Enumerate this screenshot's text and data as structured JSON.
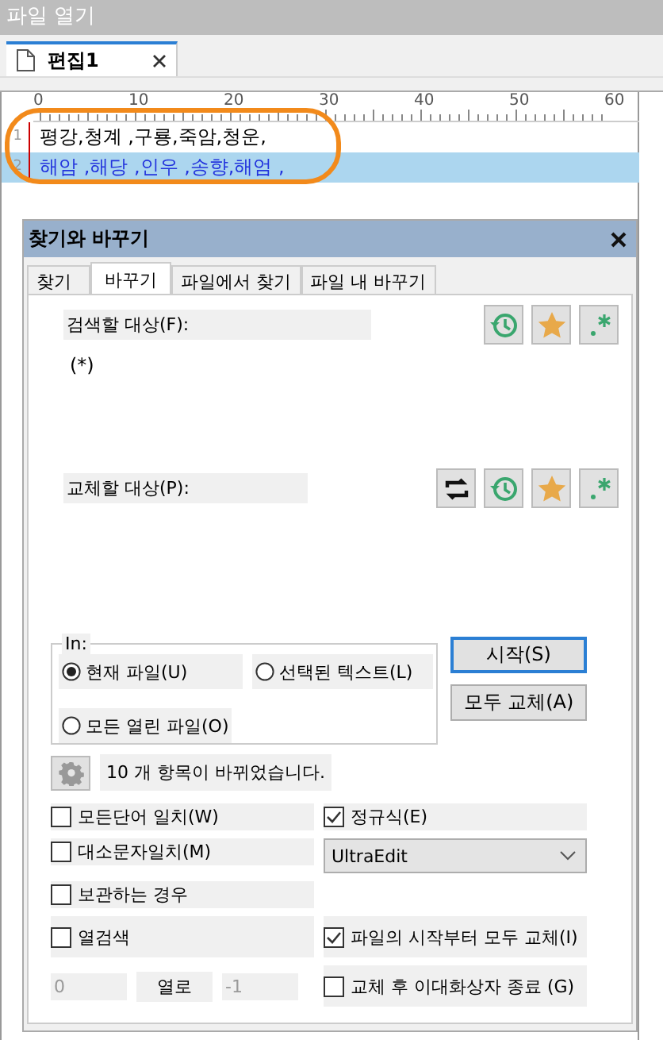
{
  "window": {
    "title": "파일 열기"
  },
  "tabs": [
    {
      "label": "편집1",
      "selected": true
    }
  ],
  "ruler": [
    "0",
    "10",
    "20",
    "30",
    "40",
    "50",
    "60"
  ],
  "lines": [
    {
      "number": "1",
      "text": "평강,청계 ,구룡,죽암,청운,",
      "selected": false
    },
    {
      "number": "2",
      "text": "해암 ,해당 ,인우 ,송향,해엄 ,",
      "selected": true
    }
  ],
  "dialog": {
    "title": "찾기와 바꾸기",
    "tabs": [
      {
        "label": "찾기",
        "selected": false
      },
      {
        "label": "바꾸기",
        "selected": true
      },
      {
        "label": "파일에서 찾기",
        "selected": false
      },
      {
        "label": "파일 내 바꾸기",
        "selected": false
      }
    ],
    "find": {
      "label": "검색할 대상(F):",
      "value": "(*)"
    },
    "replace": {
      "label": "교체할 대상(P):"
    },
    "scope": {
      "label": "In:",
      "options": [
        {
          "label": "현재 파일(U)",
          "selected": true
        },
        {
          "label": "선택된 텍스트(L)",
          "selected": false
        },
        {
          "label": "모든 열린 파일(O)",
          "selected": false
        }
      ]
    },
    "buttons": [
      {
        "label": "시작(S)",
        "default": true
      },
      {
        "label": "모두 교체(A)",
        "default": false
      }
    ],
    "status": "10 개 항목이 바뀌었습니다.",
    "options_left": [
      {
        "label": "모든단어 일치(W)",
        "checked": false
      },
      {
        "label": "대소문자일치(M)",
        "checked": false
      },
      {
        "label": "보관하는 경우",
        "checked": false
      },
      {
        "label": "열검색",
        "checked": false
      }
    ],
    "regex": {
      "label": "정규식(E)",
      "checked": true
    },
    "regex_engine": "UltraEdit",
    "options_right": [
      {
        "label": "파일의 시작부터 모두 교체(I)",
        "checked": true
      },
      {
        "label": "교체 후 이대화상자 종료 (G)",
        "checked": false
      }
    ],
    "columns": {
      "from": "0",
      "label": "열로",
      "to": "-1"
    }
  }
}
